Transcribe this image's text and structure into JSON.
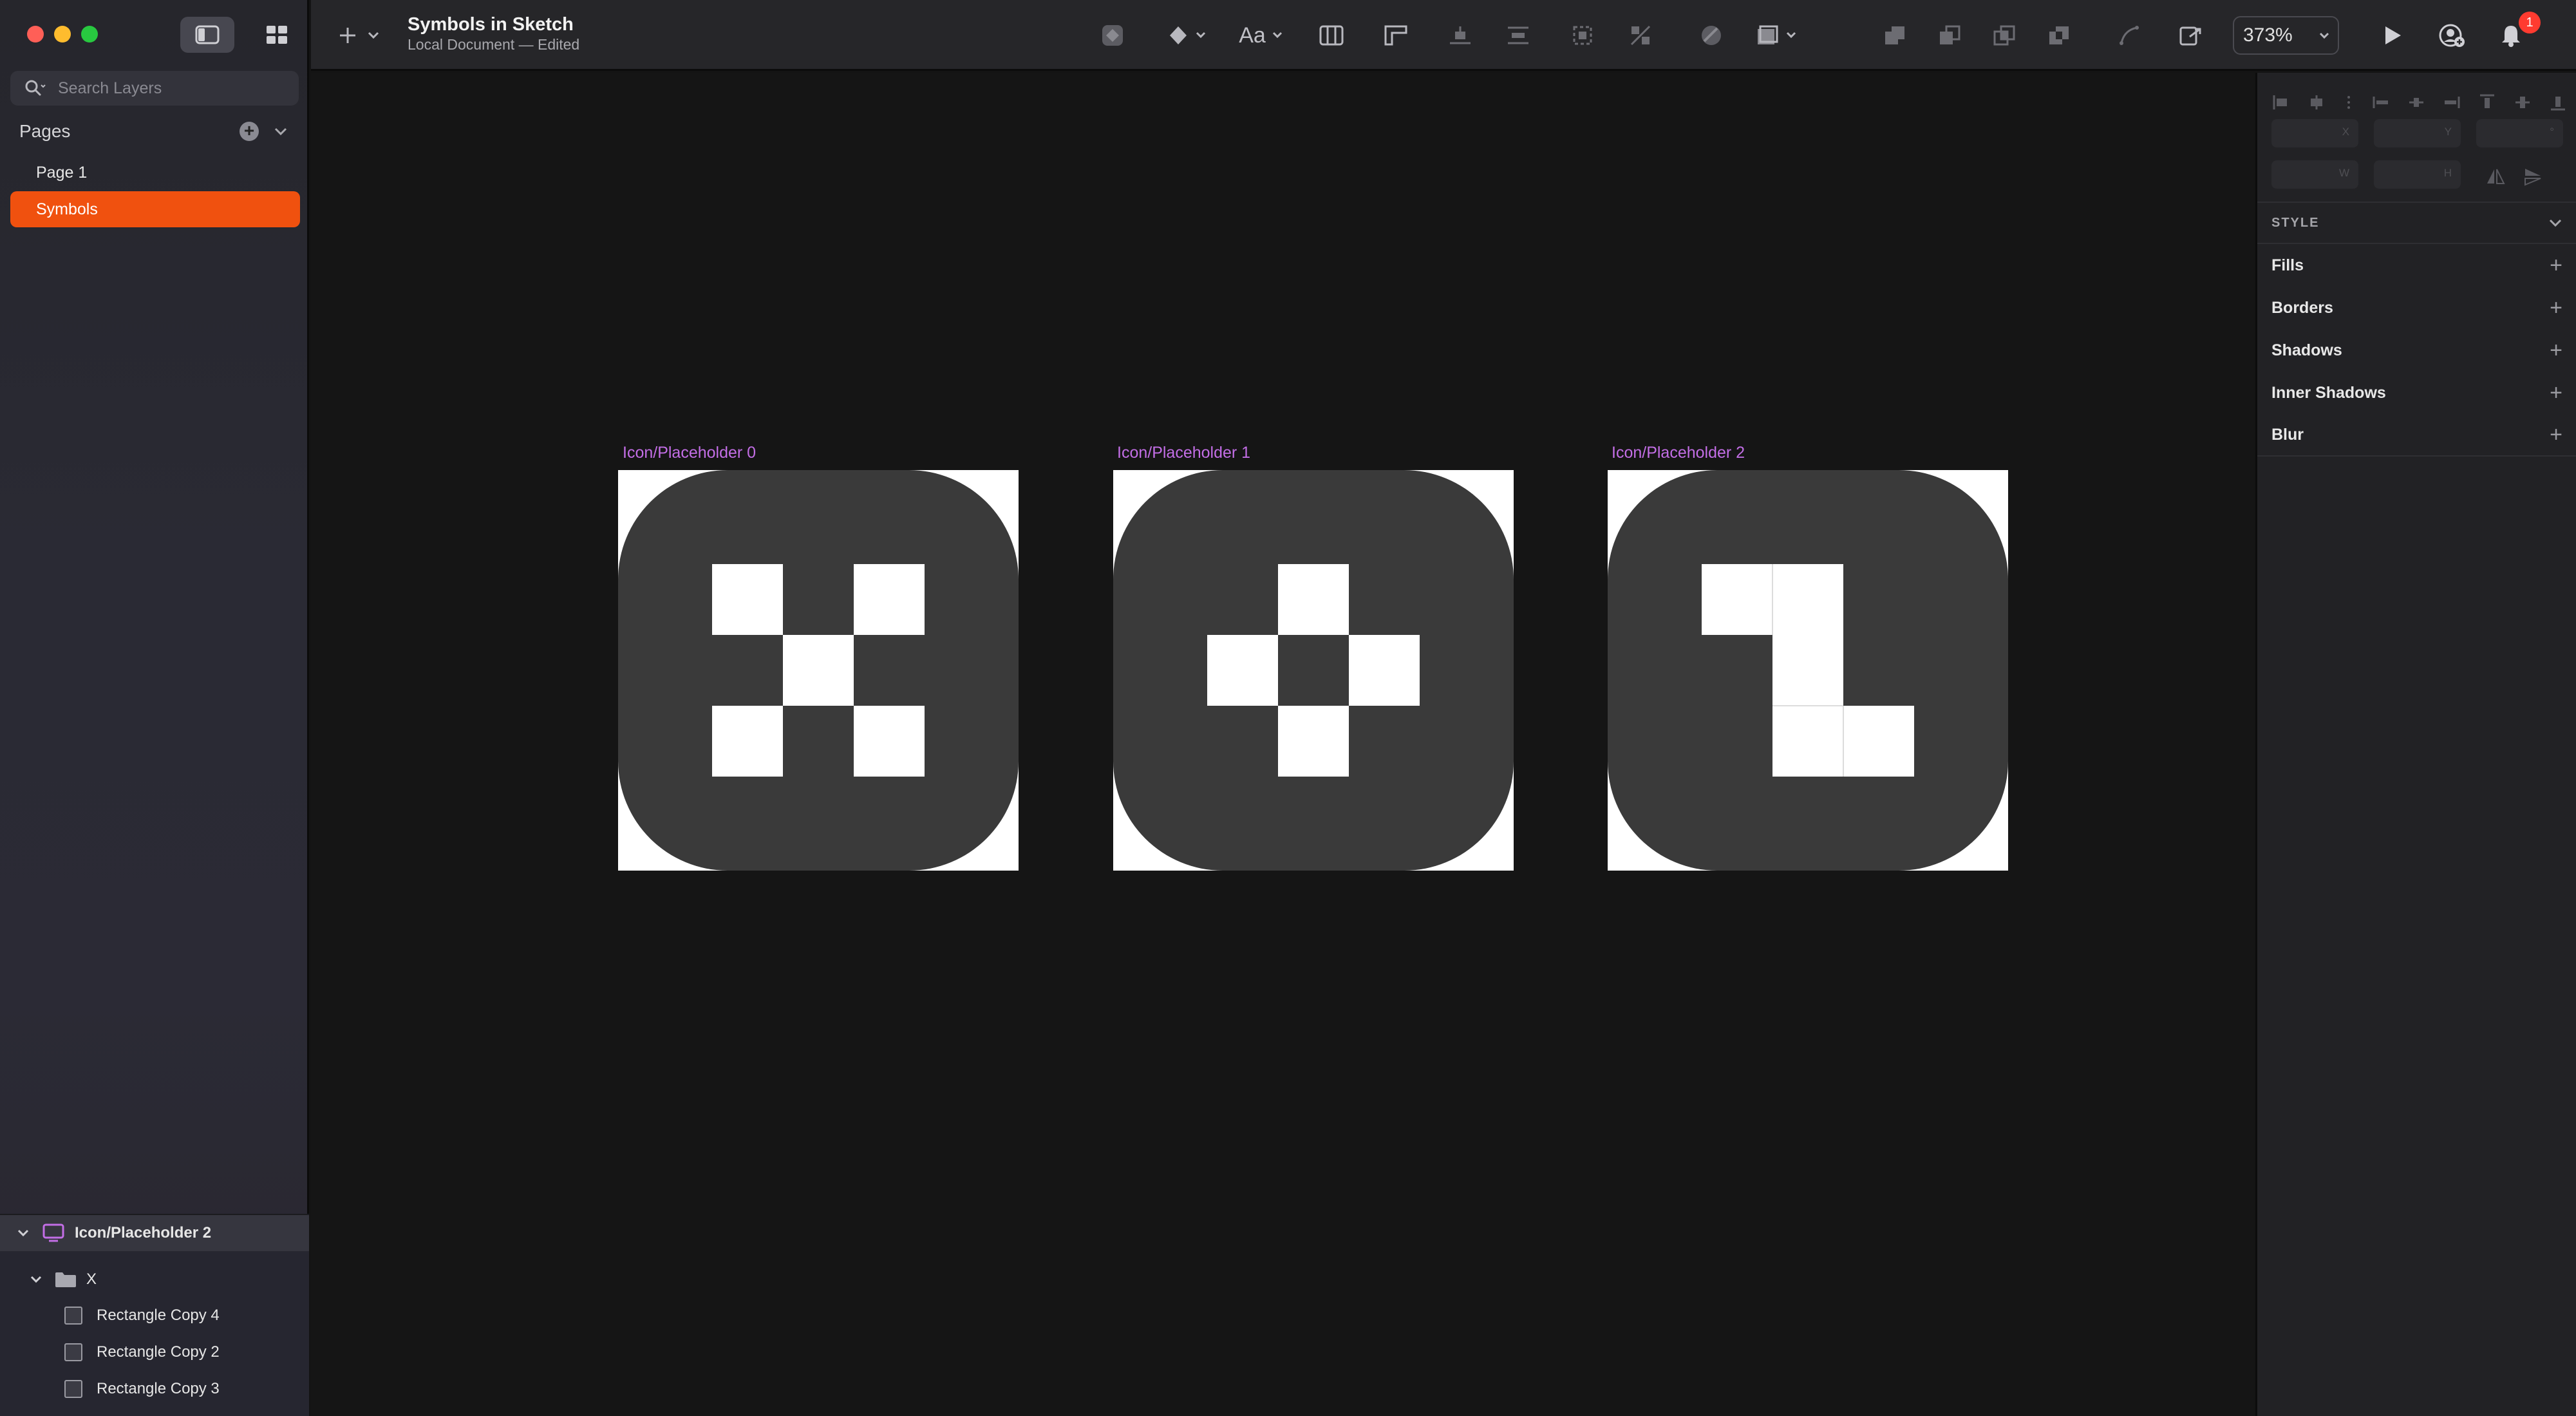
{
  "window": {
    "doc_title": "Symbols in Sketch",
    "doc_subtitle": "Local Document — Edited"
  },
  "sidebar": {
    "search_placeholder": "Search Layers",
    "pages_title": "Pages",
    "pages": [
      {
        "label": "Page 1",
        "selected": false
      },
      {
        "label": "Symbols",
        "selected": true
      }
    ],
    "layers": {
      "symbol": "Icon/Placeholder 2",
      "group": "X",
      "items": [
        "Rectangle Copy 4",
        "Rectangle Copy 2",
        "Rectangle Copy 3"
      ]
    }
  },
  "toolbar": {
    "zoom": "373%",
    "notification_count": "1"
  },
  "canvas": {
    "artboards": [
      {
        "label": "Icon/Placeholder 0",
        "pattern": "x"
      },
      {
        "label": "Icon/Placeholder 1",
        "pattern": "plus"
      },
      {
        "label": "Icon/Placeholder 2",
        "pattern": "z"
      }
    ]
  },
  "inspector": {
    "coords": {
      "x": "X",
      "y": "Y",
      "r": "°",
      "w": "W",
      "h": "H"
    },
    "style_title": "STYLE",
    "properties": [
      "Fills",
      "Borders",
      "Shadows",
      "Inner Shadows",
      "Blur"
    ]
  },
  "colors": {
    "accent": "#f0510f",
    "artboard_label": "#c36ee6",
    "icon_tile": "#3a3a3a",
    "notification": "#ff3b30"
  }
}
